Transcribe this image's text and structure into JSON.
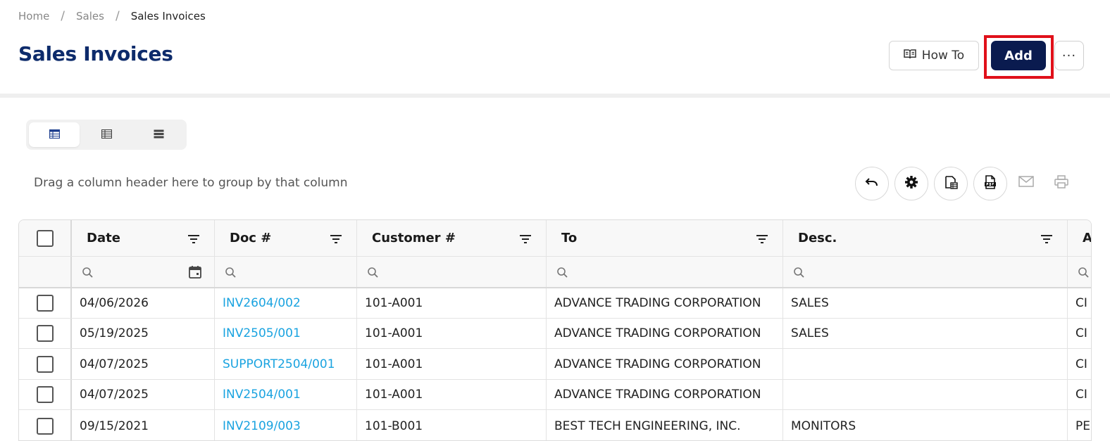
{
  "breadcrumb": {
    "items": [
      "Home",
      "Sales",
      "Sales Invoices"
    ],
    "separator": "/"
  },
  "page": {
    "title": "Sales Invoices"
  },
  "actions": {
    "howto_label": "How To",
    "add_label": "Add",
    "more_label": "···"
  },
  "grid": {
    "group_hint": "Drag a column header here to group by that column",
    "columns": [
      "Date",
      "Doc #",
      "Customer #",
      "To",
      "Desc.",
      "A"
    ],
    "rows": [
      {
        "date": "04/06/2026",
        "doc": "INV2604/002",
        "customer": "101-A001",
        "to": "ADVANCE TRADING CORPORATION",
        "desc": "SALES",
        "extra": "CI"
      },
      {
        "date": "05/19/2025",
        "doc": "INV2505/001",
        "customer": "101-A001",
        "to": "ADVANCE TRADING CORPORATION",
        "desc": "SALES",
        "extra": "CI"
      },
      {
        "date": "04/07/2025",
        "doc": "SUPPORT2504/001",
        "customer": "101-A001",
        "to": "ADVANCE TRADING CORPORATION",
        "desc": "",
        "extra": "CI"
      },
      {
        "date": "04/07/2025",
        "doc": "INV2504/001",
        "customer": "101-A001",
        "to": "ADVANCE TRADING CORPORATION",
        "desc": "",
        "extra": "CI"
      },
      {
        "date": "09/15/2021",
        "doc": "INV2109/003",
        "customer": "101-B001",
        "to": "BEST TECH ENGINEERING, INC.",
        "desc": "MONITORS",
        "extra": "PE"
      }
    ]
  },
  "colors": {
    "title": "#0d2b6b",
    "primary": "#0a1b4f",
    "link": "#1aa3e0",
    "highlight": "#e0101a"
  },
  "icons": {
    "howto": "book-open-icon",
    "views": [
      "table-view-icon",
      "compact-table-icon",
      "card-view-icon"
    ],
    "toolbar": [
      "undo-icon",
      "gear-icon",
      "export-excel-icon",
      "export-pdf-icon",
      "email-icon",
      "print-icon"
    ]
  }
}
